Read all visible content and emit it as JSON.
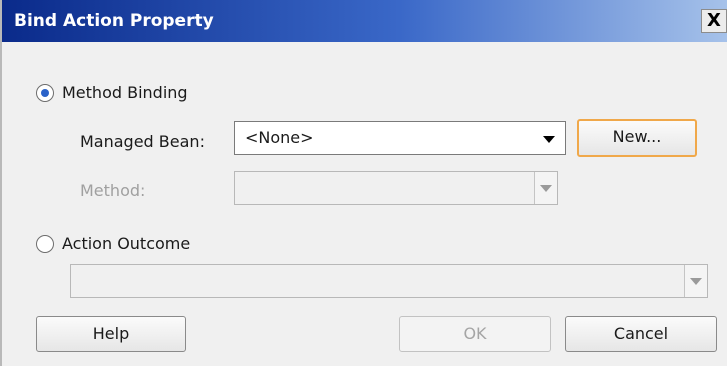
{
  "dialog": {
    "title": "Bind Action Property",
    "close_label": "X"
  },
  "method_binding": {
    "label": "Method Binding",
    "selected": true,
    "managed_bean_label": "Managed Bean:",
    "managed_bean_value": "<None>",
    "new_button": "New...",
    "method_label": "Method:",
    "method_value": "",
    "method_enabled": false
  },
  "action_outcome": {
    "label": "Action Outcome",
    "selected": false,
    "value": "",
    "enabled": false
  },
  "buttons": {
    "help": "Help",
    "ok": "OK",
    "ok_enabled": false,
    "cancel": "Cancel"
  },
  "colors": {
    "title_gradient_start": "#0a2a8a",
    "title_gradient_end": "#a6c2ea",
    "focus_border": "#f0a84a",
    "radio_selected": "#2b63c9"
  }
}
